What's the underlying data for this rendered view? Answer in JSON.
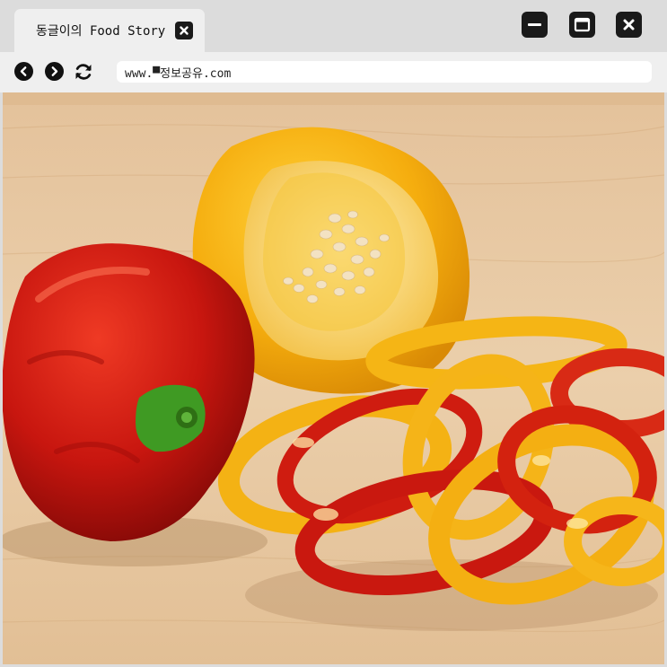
{
  "browser": {
    "tab": {
      "title": "동글이의 Food Story",
      "close_icon": "close-icon"
    },
    "window_controls": [
      "minimize-icon",
      "maximize-icon",
      "close-icon"
    ],
    "toolbar": {
      "back_icon": "chevron-left-icon",
      "forward_icon": "chevron-right-icon",
      "reload_icon": "reload-icon",
      "url": "www.▀정보공유.com"
    }
  },
  "content": {
    "image": "photo of a whole red bell pepper, a halved yellow bell pepper and sliced red and yellow pepper rings on a wooden board"
  },
  "colors": {
    "chrome": "#dcdcdc",
    "tab_bg": "#efefef",
    "button_dark": "#1a1a1a",
    "wood": "#e6c8a2",
    "red_pepper": "#c8160f",
    "yellow_pepper": "#f2b010"
  }
}
